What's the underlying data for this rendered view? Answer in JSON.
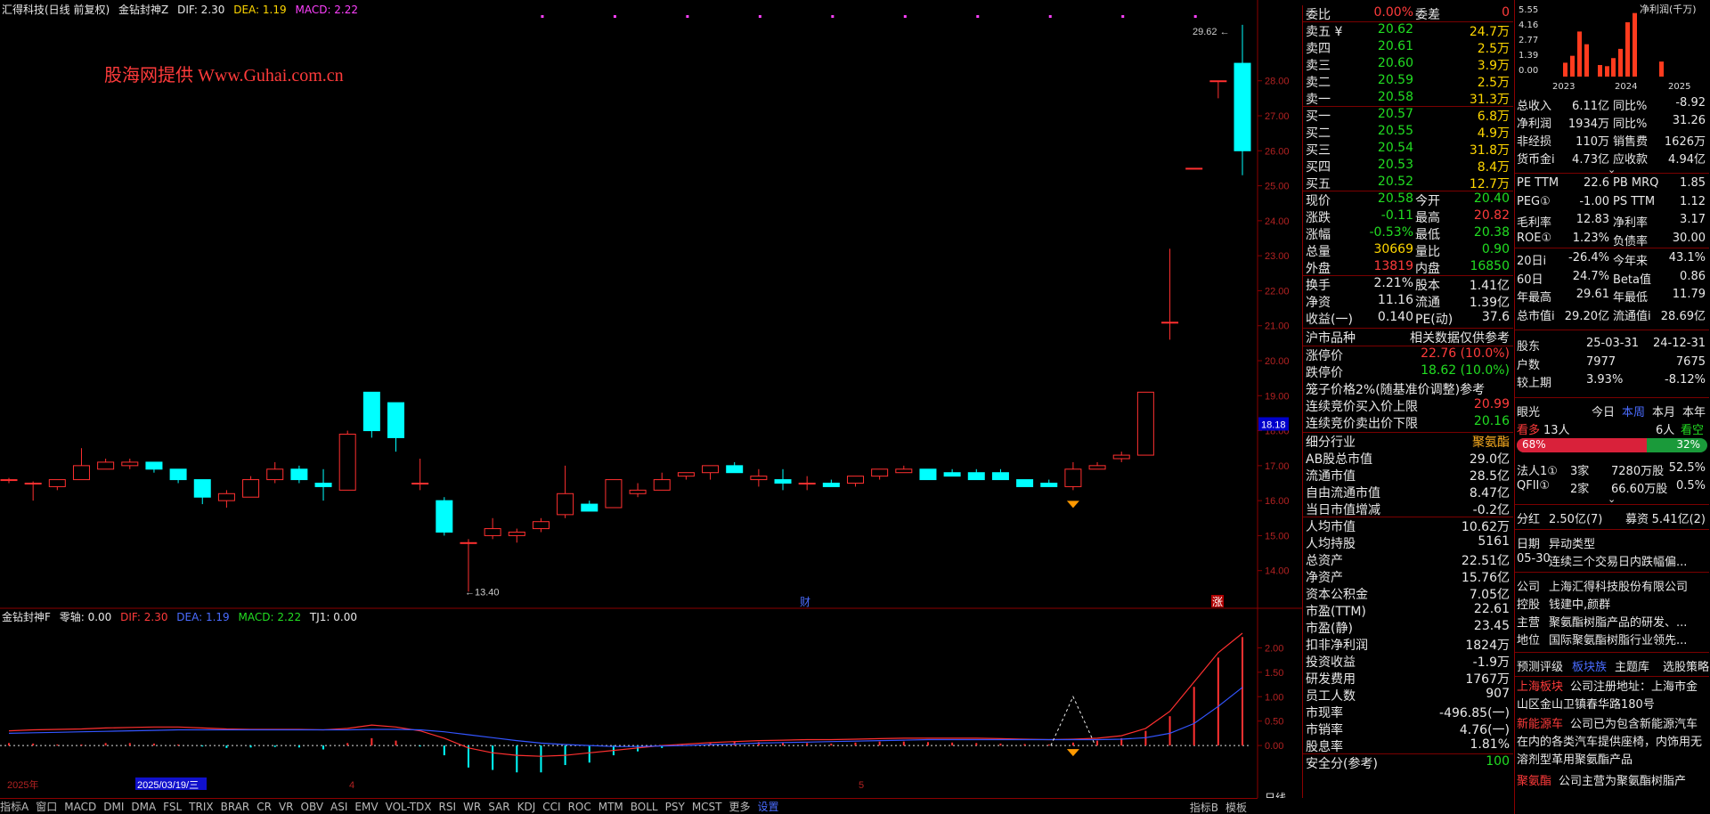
{
  "header": {
    "stock": "汇得科技(日线 前复权)",
    "indicator": "金钻封神Z",
    "dif": "DIF: 2.30",
    "dea": "DEA: 1.19",
    "macd": "MACD: 2.22",
    "watermark": "股海网提供  Www.Guhai.com.cn"
  },
  "sub_header": {
    "indicator": "金钻封神F",
    "zero": "零轴: 0.00",
    "dif": "DIF: 2.30",
    "dea": "DEA: 1.19",
    "macd": "MACD: 2.22",
    "tj1": "TJ1: 0.00"
  },
  "price_axis": [
    "28.00",
    "27.00",
    "26.00",
    "25.00",
    "24.00",
    "23.00",
    "22.00",
    "21.00",
    "20.00",
    "19.00",
    "18.00",
    "17.00",
    "16.00",
    "15.00",
    "14.00"
  ],
  "sub_axis": [
    "2.00",
    "1.50",
    "1.00",
    "0.50",
    "0.00"
  ],
  "current_price_tag": "18.18",
  "high_label": "29.62",
  "low_label": "13.40",
  "markers": {
    "cai": "财",
    "zhang": "涨"
  },
  "date_axis": [
    "2025年",
    "2025/03/19/三",
    "4",
    "5",
    "日线"
  ],
  "chart_data": {
    "type": "candlestick",
    "ylim": [
      13.0,
      29.8
    ],
    "candles": [
      [
        16.6,
        16.65,
        16.5,
        16.6
      ],
      [
        16.5,
        16.55,
        16.0,
        16.5
      ],
      [
        16.4,
        16.6,
        16.3,
        16.6
      ],
      [
        16.6,
        17.5,
        16.6,
        17.0
      ],
      [
        16.9,
        17.2,
        16.9,
        17.1
      ],
      [
        17.0,
        17.2,
        16.9,
        17.1
      ],
      [
        17.1,
        17.1,
        16.8,
        16.9
      ],
      [
        16.9,
        16.9,
        16.5,
        16.6
      ],
      [
        16.6,
        16.6,
        15.9,
        16.1
      ],
      [
        16.0,
        16.3,
        15.8,
        16.2
      ],
      [
        16.1,
        16.7,
        16.1,
        16.6
      ],
      [
        16.6,
        17.1,
        16.5,
        16.9
      ],
      [
        16.9,
        17.0,
        16.5,
        16.6
      ],
      [
        16.5,
        16.9,
        16.0,
        16.4
      ],
      [
        16.3,
        18.0,
        16.3,
        17.9
      ],
      [
        19.1,
        19.1,
        17.8,
        18.0
      ],
      [
        18.8,
        18.8,
        17.4,
        17.8
      ],
      [
        16.5,
        17.2,
        16.3,
        16.5
      ],
      [
        16.0,
        16.1,
        15.0,
        15.1
      ],
      [
        14.8,
        14.9,
        13.4,
        14.8
      ],
      [
        15.0,
        15.5,
        14.9,
        15.2
      ],
      [
        15.0,
        15.2,
        14.8,
        15.1
      ],
      [
        15.2,
        15.5,
        15.1,
        15.4
      ],
      [
        15.6,
        17.0,
        15.5,
        16.2
      ],
      [
        15.9,
        16.0,
        15.7,
        15.7
      ],
      [
        15.8,
        16.6,
        15.8,
        16.6
      ],
      [
        16.2,
        16.5,
        16.1,
        16.3
      ],
      [
        16.3,
        16.8,
        16.3,
        16.6
      ],
      [
        16.7,
        16.8,
        16.6,
        16.8
      ],
      [
        16.8,
        17.0,
        16.6,
        17.0
      ],
      [
        17.0,
        17.1,
        16.8,
        16.8
      ],
      [
        16.6,
        16.9,
        16.4,
        16.7
      ],
      [
        16.6,
        16.9,
        16.3,
        16.5
      ],
      [
        16.5,
        16.7,
        16.3,
        16.5
      ],
      [
        16.5,
        16.6,
        16.4,
        16.4
      ],
      [
        16.5,
        16.7,
        16.4,
        16.7
      ],
      [
        16.7,
        16.9,
        16.6,
        16.9
      ],
      [
        16.8,
        17.0,
        16.8,
        16.9
      ],
      [
        16.9,
        16.9,
        16.6,
        16.6
      ],
      [
        16.8,
        16.9,
        16.7,
        16.7
      ],
      [
        16.8,
        16.9,
        16.7,
        16.6
      ],
      [
        16.8,
        16.9,
        16.7,
        16.6
      ],
      [
        16.6,
        16.6,
        16.4,
        16.4
      ],
      [
        16.5,
        16.6,
        16.4,
        16.4
      ],
      [
        16.4,
        17.1,
        16.3,
        16.9
      ],
      [
        16.9,
        17.1,
        16.9,
        17.0
      ],
      [
        17.2,
        17.4,
        17.1,
        17.3
      ],
      [
        17.3,
        19.1,
        17.3,
        19.1
      ],
      [
        21.1,
        23.2,
        20.6,
        21.1
      ],
      [
        25.5,
        25.5,
        25.5,
        25.5
      ],
      [
        28.0,
        28.0,
        27.5,
        28.0
      ],
      [
        28.5,
        29.6,
        25.3,
        26.0
      ]
    ],
    "macd_hist": [
      0.05,
      0.04,
      0.02,
      0.02,
      0.05,
      0.05,
      0.04,
      0.02,
      -0.02,
      -0.05,
      -0.04,
      -0.03,
      -0.04,
      -0.08,
      0.05,
      0.15,
      0.1,
      -0.02,
      -0.2,
      -0.45,
      -0.5,
      -0.55,
      -0.55,
      -0.4,
      -0.35,
      -0.2,
      -0.12,
      -0.05,
      0.0,
      0.05,
      0.08,
      0.07,
      0.06,
      0.05,
      0.04,
      0.06,
      0.08,
      0.08,
      0.07,
      0.06,
      0.05,
      0.04,
      0.03,
      0.02,
      0.06,
      0.1,
      0.15,
      0.3,
      0.6,
      1.2,
      1.8,
      2.22
    ],
    "dif": [
      0.3,
      0.32,
      0.33,
      0.34,
      0.36,
      0.37,
      0.38,
      0.38,
      0.36,
      0.34,
      0.33,
      0.33,
      0.33,
      0.32,
      0.35,
      0.42,
      0.38,
      0.3,
      0.15,
      -0.05,
      -0.15,
      -0.2,
      -0.22,
      -0.2,
      -0.15,
      -0.1,
      -0.05,
      0.0,
      0.03,
      0.06,
      0.08,
      0.1,
      0.11,
      0.12,
      0.12,
      0.13,
      0.14,
      0.15,
      0.15,
      0.15,
      0.15,
      0.14,
      0.13,
      0.12,
      0.13,
      0.15,
      0.2,
      0.35,
      0.7,
      1.3,
      1.9,
      2.3
    ],
    "dea": [
      0.25,
      0.26,
      0.27,
      0.28,
      0.29,
      0.3,
      0.31,
      0.32,
      0.32,
      0.32,
      0.32,
      0.32,
      0.32,
      0.32,
      0.32,
      0.33,
      0.33,
      0.32,
      0.28,
      0.22,
      0.16,
      0.1,
      0.05,
      0.02,
      0.0,
      -0.02,
      -0.02,
      -0.01,
      0.0,
      0.02,
      0.03,
      0.05,
      0.06,
      0.07,
      0.08,
      0.09,
      0.1,
      0.11,
      0.12,
      0.12,
      0.12,
      0.12,
      0.12,
      0.12,
      0.12,
      0.12,
      0.13,
      0.16,
      0.25,
      0.45,
      0.8,
      1.19
    ]
  },
  "quote": {
    "rows": [
      {
        "l": "委比",
        "v": "0.00%",
        "l2": "委差",
        "v2": "0",
        "lc": "wht",
        "vc": "red",
        "l2c": "wht",
        "v2c": "red"
      },
      {
        "l": "卖五 ¥",
        "v": "20.62",
        "l2": "",
        "v2": "24.7万",
        "lc": "wht",
        "vc": "grn",
        "v2c": "yel"
      },
      {
        "l": "卖四",
        "v": "20.61",
        "l2": "",
        "v2": "2.5万",
        "lc": "wht",
        "vc": "grn",
        "v2c": "yel"
      },
      {
        "l": "卖三",
        "v": "20.60",
        "l2": "",
        "v2": "3.9万",
        "lc": "wht",
        "vc": "grn",
        "v2c": "yel"
      },
      {
        "l": "卖二",
        "v": "20.59",
        "l2": "",
        "v2": "2.5万",
        "lc": "wht",
        "vc": "grn",
        "v2c": "yel"
      },
      {
        "l": "卖一",
        "v": "20.58",
        "l2": "",
        "v2": "31.3万",
        "lc": "wht",
        "vc": "grn",
        "v2c": "yel"
      },
      {
        "l": "买一",
        "v": "20.57",
        "l2": "",
        "v2": "6.8万",
        "lc": "wht",
        "vc": "grn",
        "v2c": "yel"
      },
      {
        "l": "买二",
        "v": "20.55",
        "l2": "",
        "v2": "4.9万",
        "lc": "wht",
        "vc": "grn",
        "v2c": "yel"
      },
      {
        "l": "买三",
        "v": "20.54",
        "l2": "",
        "v2": "31.8万",
        "lc": "wht",
        "vc": "grn",
        "v2c": "yel"
      },
      {
        "l": "买四",
        "v": "20.53",
        "l2": "",
        "v2": "8.4万",
        "lc": "wht",
        "vc": "grn",
        "v2c": "yel"
      },
      {
        "l": "买五",
        "v": "20.52",
        "l2": "",
        "v2": "12.7万",
        "lc": "wht",
        "vc": "grn",
        "v2c": "yel"
      },
      {
        "l": "现价",
        "v": "20.58",
        "l2": "今开",
        "v2": "20.40",
        "lc": "wht",
        "vc": "grn",
        "l2c": "wht",
        "v2c": "grn"
      },
      {
        "l": "涨跌",
        "v": "-0.11",
        "l2": "最高",
        "v2": "20.82",
        "lc": "wht",
        "vc": "grn",
        "l2c": "wht",
        "v2c": "red"
      },
      {
        "l": "涨幅",
        "v": "-0.53%",
        "l2": "最低",
        "v2": "20.38",
        "lc": "wht",
        "vc": "grn",
        "l2c": "wht",
        "v2c": "grn"
      },
      {
        "l": "总量",
        "v": "30669",
        "l2": "量比",
        "v2": "0.90",
        "lc": "wht",
        "vc": "yel",
        "l2c": "wht",
        "v2c": "grn"
      },
      {
        "l": "外盘",
        "v": "13819",
        "l2": "内盘",
        "v2": "16850",
        "lc": "wht",
        "vc": "red",
        "l2c": "wht",
        "v2c": "grn"
      },
      {
        "l": "换手",
        "v": "2.21%",
        "l2": "股本",
        "v2": "1.41亿",
        "lc": "wht",
        "vc": "wht",
        "l2c": "wht",
        "v2c": "wht"
      },
      {
        "l": "净资",
        "v": "11.16",
        "l2": "流通",
        "v2": "1.39亿",
        "lc": "wht",
        "vc": "wht",
        "l2c": "wht",
        "v2c": "wht"
      },
      {
        "l": "收益(一)",
        "v": "0.140",
        "l2": "PE(动)",
        "v2": "37.6",
        "lc": "wht",
        "vc": "wht",
        "l2c": "wht",
        "v2c": "wht"
      }
    ],
    "market_title": "沪市品种",
    "market_note": "相关数据仅供参考",
    "limit_up_label": "涨停价",
    "limit_up": "22.76 (10.0%)",
    "limit_down_label": "跌停价",
    "limit_down": "18.62 (10.0%)",
    "cage_note": "笼子价格2%(随基准价调整)参考",
    "cont_buy_label": "连续竞价买入价上限",
    "cont_buy": "20.99",
    "cont_sell_label": "连续竞价卖出价下限",
    "cont_sell": "20.16",
    "fin": [
      {
        "l": "细分行业",
        "v": "聚氨酯",
        "vc": "org"
      },
      {
        "l": "AB股总市值",
        "v": "29.0亿"
      },
      {
        "l": "流通市值",
        "v": "28.5亿"
      },
      {
        "l": "自由流通市值",
        "v": "8.47亿"
      },
      {
        "l": "当日市值增减",
        "v": "-0.2亿"
      },
      {
        "l": "人均市值",
        "v": "10.62万"
      },
      {
        "l": "人均持股",
        "v": "5161"
      },
      {
        "l": "总资产",
        "v": "22.51亿"
      },
      {
        "l": "净资产",
        "v": "15.76亿"
      },
      {
        "l": "资本公积金",
        "v": "7.05亿"
      },
      {
        "l": "市盈(TTM)",
        "v": "22.61"
      },
      {
        "l": "市盈(静)",
        "v": "23.45"
      },
      {
        "l": "扣非净利润",
        "v": "1824万"
      },
      {
        "l": "投资收益",
        "v": "-1.9万"
      },
      {
        "l": "研发费用",
        "v": "1767万"
      },
      {
        "l": "员工人数",
        "v": "907"
      },
      {
        "l": "市现率",
        "v": "-496.85(一)"
      },
      {
        "l": "市销率",
        "v": "4.76(一)"
      },
      {
        "l": "股息率",
        "v": "1.81%"
      },
      {
        "l": "安全分(参考)",
        "v": "100",
        "vc": "grn"
      }
    ]
  },
  "right": {
    "mini_title": "净利润(千万)",
    "mini_y": [
      "5.55",
      "4.16",
      "2.77",
      "1.39",
      "0.00"
    ],
    "mini_x": [
      "2023",
      "2024",
      "2025"
    ],
    "mini_values": [
      1.2,
      1.8,
      3.9,
      2.8,
      1.0,
      0.9,
      1.6,
      2.4,
      4.7,
      5.5,
      1.3
    ],
    "rows1": [
      {
        "a": "总收入",
        "b": "6.11亿",
        "c": "同比%",
        "d": "-8.92"
      },
      {
        "a": "净利润",
        "b": "1934万",
        "c": "同比%",
        "d": "31.26"
      },
      {
        "a": "非经损",
        "b": "110万",
        "c": "销售费",
        "d": "1626万"
      },
      {
        "a": "货币金i",
        "b": "4.73亿",
        "c": "应收款",
        "d": "4.94亿"
      }
    ],
    "rows2": [
      {
        "a": "PE TTM",
        "b": "22.6",
        "c": "PB MRQ",
        "d": "1.85"
      },
      {
        "a": "PEG①",
        "b": "-1.00",
        "c": "PS TTM",
        "d": "1.12"
      },
      {
        "a": "毛利率",
        "b": "12.83",
        "c": "净利率",
        "d": "3.17"
      },
      {
        "a": "ROE①",
        "b": "1.23%",
        "c": "负债率",
        "d": "30.00"
      },
      {
        "a": "20日i",
        "b": "-26.4%",
        "c": "今年来",
        "d": "43.1%"
      },
      {
        "a": "60日",
        "b": "24.7%",
        "c": "Beta值",
        "d": "0.86"
      },
      {
        "a": "年最高",
        "b": "29.61",
        "c": "年最低",
        "d": "11.79"
      },
      {
        "a": "总市值i",
        "b": "29.20亿",
        "c": "流通值i",
        "d": "28.69亿"
      }
    ],
    "holders": [
      {
        "a": "股东",
        "b": "25-03-31",
        "d": "24-12-31"
      },
      {
        "a": "户数",
        "b": "7977",
        "d": "7675"
      },
      {
        "a": "较上期",
        "b": "3.93%",
        "d": "-8.12%"
      }
    ],
    "eye_title": "眼光",
    "eye_tabs": [
      "今日",
      "本周",
      "本月",
      "本年"
    ],
    "bull_label": "看多",
    "bull_count": "13人",
    "bear_count": "6人",
    "bear_label": "看空",
    "bull_pct": "68%",
    "bear_pct": "32%",
    "bull_ratio": 0.68,
    "inst": [
      {
        "a": "法人1①",
        "b": "3家",
        "c": "7280万股",
        "d": "52.5%"
      },
      {
        "a": "QFII①",
        "b": "2家",
        "c": "66.60万股",
        "d": "0.5%"
      }
    ],
    "div_label": "分红",
    "div_val": "2.50亿(7)",
    "raise_label": "募资",
    "raise_val": "5.41亿(2)",
    "abn_h1": "日期",
    "abn_h2": "异动类型",
    "abn_date": "05-30",
    "abn_text": "连续三个交易日内跌幅偏...",
    "company": [
      {
        "a": "公司",
        "b": "上海汇得科技股份有限公司"
      },
      {
        "a": "控股",
        "b": "钱建中,颜群"
      },
      {
        "a": "主营",
        "b": "聚氨酯树脂产品的研发、..."
      },
      {
        "a": "地位",
        "b": "国际聚氨酯树脂行业领先..."
      }
    ],
    "links": [
      "预测评级",
      "板块族",
      "主题库",
      "选股策略"
    ],
    "news": [
      {
        "tag": "上海板块",
        "text": "公司注册地址：上海市金山区金山卫镇春华路180号"
      },
      {
        "tag": "新能源车",
        "text": "公司已为包含新能源汽车在内的各类汽车提供座椅，内饰用无溶剂型革用聚氨酯产品"
      },
      {
        "tag": "聚氨酯",
        "text": "公司主营为聚氨酯树脂产"
      }
    ]
  },
  "bottom_tabs": [
    "指标A",
    "窗口",
    "MACD",
    "DMI",
    "DMA",
    "FSL",
    "TRIX",
    "BRAR",
    "CR",
    "VR",
    "OBV",
    "ASI",
    "EMV",
    "VOL-TDX",
    "RSI",
    "WR",
    "SAR",
    "KDJ",
    "CCI",
    "ROC",
    "MTM",
    "BOLL",
    "PSY",
    "MCST",
    "更多",
    "设置"
  ],
  "bottom_right": [
    "指标B",
    "模板"
  ]
}
